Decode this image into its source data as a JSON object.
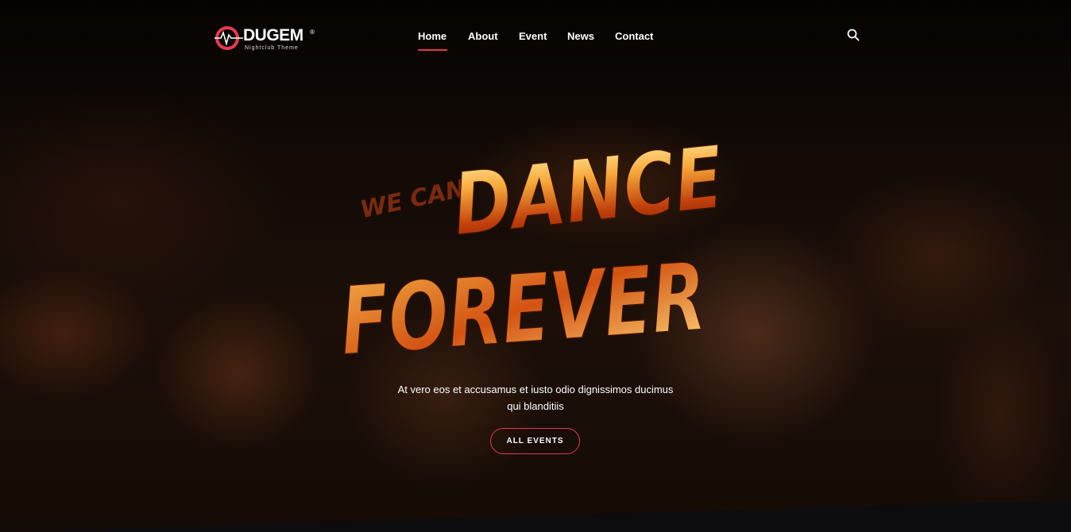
{
  "brand": {
    "name": "DUGEM",
    "registered": "®",
    "subtitle": "Nightclub Theme",
    "accent_color": "#e8394f"
  },
  "nav": {
    "items": [
      {
        "label": "Home",
        "active": true
      },
      {
        "label": "About",
        "active": false
      },
      {
        "label": "Event",
        "active": false
      },
      {
        "label": "News",
        "active": false
      },
      {
        "label": "Contact",
        "active": false
      }
    ],
    "search_icon": "search-icon"
  },
  "hero": {
    "headline_small": "WE CAN",
    "headline_main": "DANCE",
    "headline_second": "FOREVER",
    "tagline_line1": "At vero eos et accusamus et iusto odio dignissimos ducimus",
    "tagline_line2": "qui blanditiis",
    "cta_label": "ALL EVENTS",
    "headline_gradient": [
      "#fff1a8",
      "#f7a93a",
      "#c2410c",
      "#7a1d05"
    ]
  }
}
